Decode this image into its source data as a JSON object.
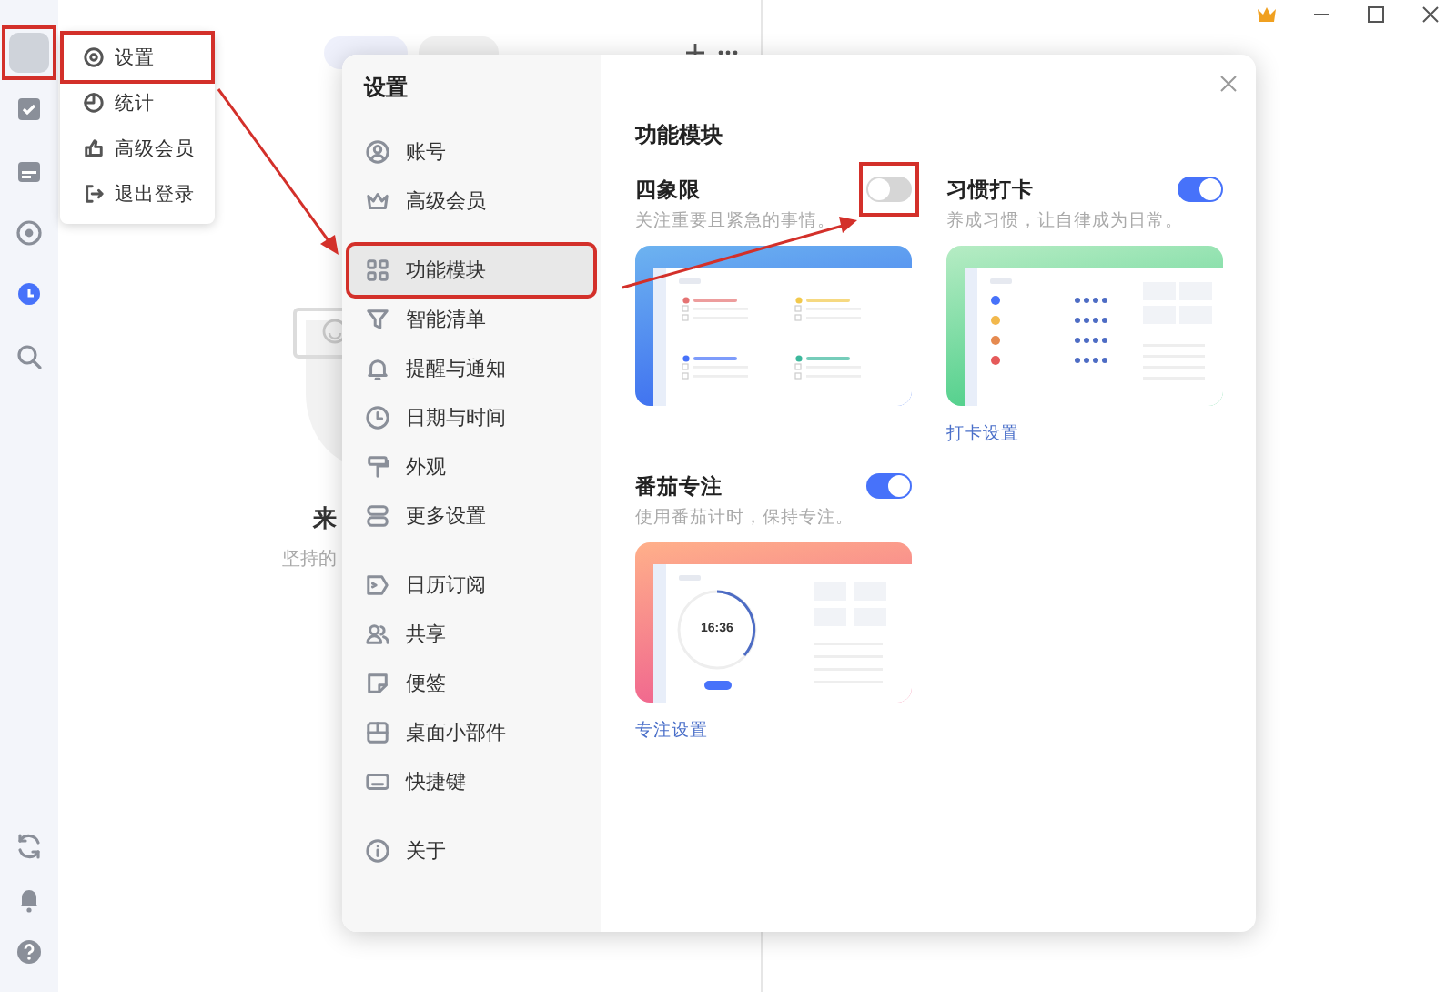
{
  "rail": {
    "avatar": {
      "highlighted": true
    },
    "items": [
      {
        "selected": false
      },
      {
        "selected": false
      },
      {
        "selected": false
      },
      {
        "selected": true
      },
      {
        "selected": false
      }
    ],
    "bottom_items": [
      {
        "selected": false
      },
      {
        "selected": false
      },
      {
        "selected": false
      }
    ]
  },
  "empty_state": {
    "title": "来",
    "hint": "坚持的"
  },
  "menu": {
    "items": [
      {
        "label": "设置",
        "highlighted": true
      },
      {
        "label": "统计",
        "highlighted": false
      },
      {
        "label": "高级会员",
        "highlighted": false
      },
      {
        "label": "退出登录",
        "highlighted": false
      }
    ]
  },
  "dialog": {
    "title": "设置",
    "nav_groups": [
      {
        "items": [
          {
            "label": "账号",
            "selected": false,
            "highlighted": false
          },
          {
            "label": "高级会员",
            "selected": false,
            "highlighted": false
          }
        ]
      },
      {
        "items": [
          {
            "label": "功能模块",
            "selected": true,
            "highlighted": true
          },
          {
            "label": "智能清单",
            "selected": false,
            "highlighted": false
          },
          {
            "label": "提醒与通知",
            "selected": false,
            "highlighted": false
          },
          {
            "label": "日期与时间",
            "selected": false,
            "highlighted": false
          },
          {
            "label": "外观",
            "selected": false,
            "highlighted": false
          },
          {
            "label": "更多设置",
            "selected": false,
            "highlighted": false
          }
        ]
      },
      {
        "items": [
          {
            "label": "日历订阅",
            "selected": false,
            "highlighted": false
          },
          {
            "label": "共享",
            "selected": false,
            "highlighted": false
          },
          {
            "label": "便签",
            "selected": false,
            "highlighted": false
          },
          {
            "label": "桌面小部件",
            "selected": false,
            "highlighted": false
          },
          {
            "label": "快捷键",
            "selected": false,
            "highlighted": false
          }
        ]
      },
      {
        "items": [
          {
            "label": "关于",
            "selected": false,
            "highlighted": false
          }
        ]
      }
    ],
    "panel": {
      "title": "功能模块",
      "modules": [
        {
          "kind": "matrix",
          "name": "四象限",
          "description": "关注重要且紧急的事情。",
          "on": false,
          "highlighted": true
        },
        {
          "kind": "habit",
          "name": "习惯打卡",
          "description": "养成习惯，让自律成为日常。",
          "on": true,
          "highlighted": false,
          "link": "打卡设置"
        },
        {
          "kind": "pomodoro",
          "name": "番茄专注",
          "description": "使用番茄计时，保持专注。",
          "on": true,
          "highlighted": false,
          "link": "专注设置",
          "preview_time": "16:36"
        }
      ]
    }
  }
}
